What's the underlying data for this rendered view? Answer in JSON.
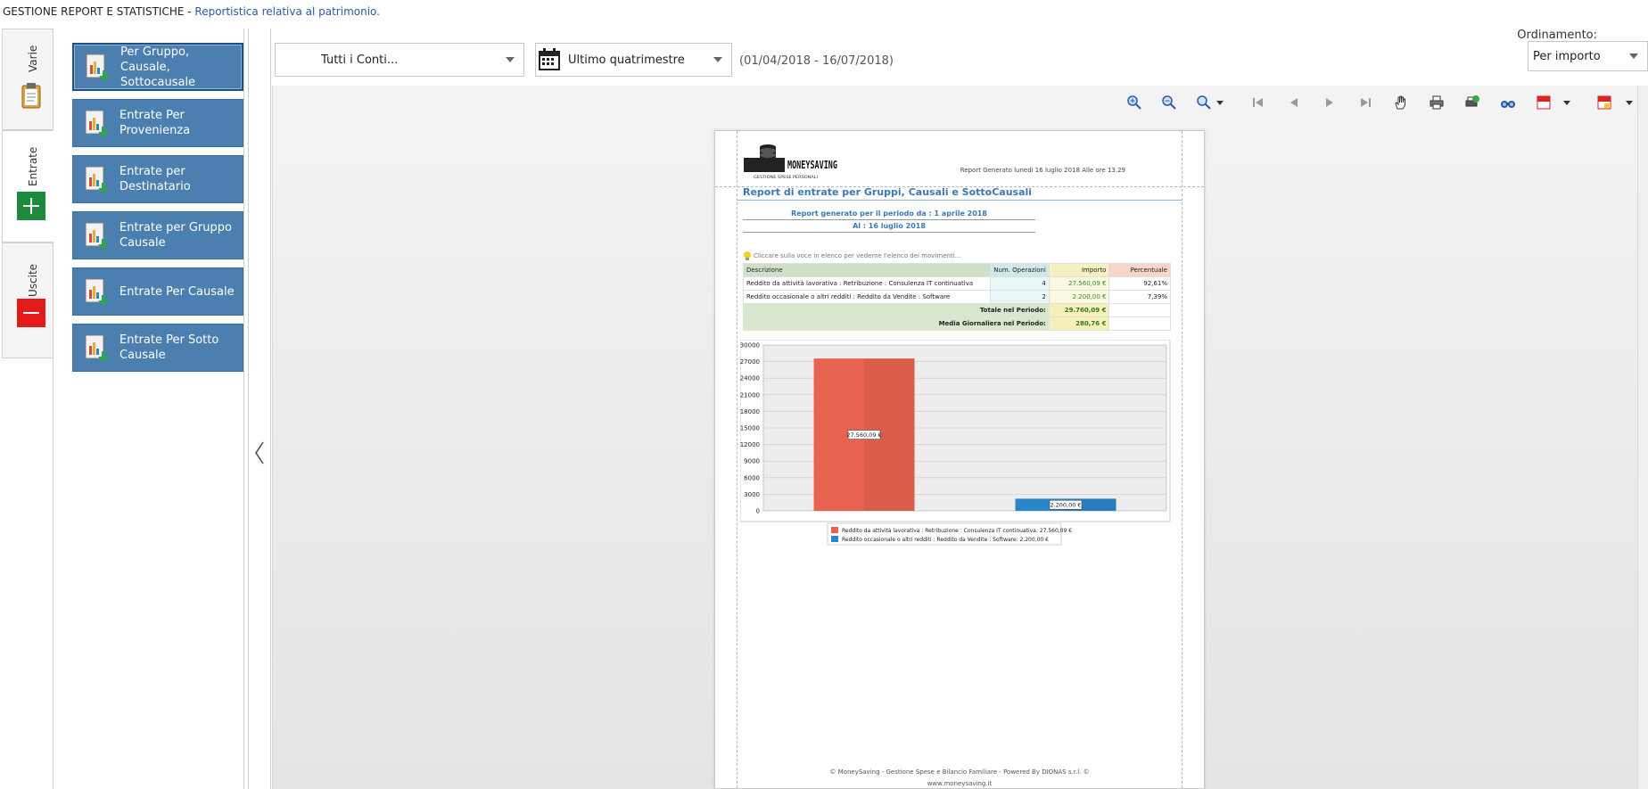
{
  "header": {
    "title": "GESTIONE REPORT E STATISTICHE",
    "separator": " - ",
    "subtitle": "Reportistica relativa al patrimonio."
  },
  "side_tabs": [
    {
      "label": "Varie",
      "icon": "clipboard-icon"
    },
    {
      "label": "Entrate",
      "icon": "plus-icon",
      "active": true
    },
    {
      "label": "Uscite",
      "icon": "minus-icon"
    }
  ],
  "report_menu": [
    {
      "label": "Per Gruppo, Causale, Sottocausale",
      "selected": true
    },
    {
      "label": "Entrate Per Provenienza"
    },
    {
      "label": "Entrate per Destinatario"
    },
    {
      "label": "Entrate per Gruppo Causale"
    },
    {
      "label": "Entrate Per Causale"
    },
    {
      "label": "Entrate Per Sotto Causale"
    }
  ],
  "filters": {
    "accounts_value": "Tutti i Conti...",
    "period_value": "Ultimo quatrimestre",
    "period_range": "(01/04/2018 - 16/07/2018)",
    "ordering_label": "Ordinamento:",
    "ordering_value": "Per importo"
  },
  "toolbar_icons": [
    "zoom-in-icon",
    "zoom-out-icon",
    "zoom-icon",
    "first-page-icon",
    "previous-page-icon",
    "next-page-icon",
    "last-page-icon",
    "hand-tool-icon",
    "print-icon",
    "print-preview-icon",
    "find-icon",
    "export-pdf-icon",
    "send-pdf-icon"
  ],
  "report": {
    "logo_main": "MONEYSAVING",
    "logo_sub": "GESTIONE SPESE PERSONALI",
    "generated_note": "Report Generato lunedì 16 luglio 2018 Alle ore 13.29",
    "title": "Report di entrate per Gruppi, Causali e SottoCausali",
    "period_from": "Report generato per il periodo da : 1 aprile 2018",
    "period_to": "Al : 16 luglio 2018",
    "hint": "Cliccare sulla voce in elenco per vederne l'elenco dei movimenti...",
    "columns": [
      "Descrizione",
      "Num. Operazioni",
      "Importo",
      "Percentuale"
    ],
    "rows": [
      {
        "desc": "Reddito da attività lavorativa : Retribuzione : Consulenza IT continuativa",
        "num": "4",
        "amount": "27.560,09 €",
        "perc": "92,61%"
      },
      {
        "desc": "Reddito occasionale o altri redditi : Reddito da Vendite : Software",
        "num": "2",
        "amount": "2.200,00 €",
        "perc": "7,39%"
      }
    ],
    "total_label": "Totale nel Periodo:",
    "total_value": "29.760,09 €",
    "avg_label": "Media Giornaliera nel Periodo:",
    "avg_value": "280,76 €",
    "footer_1": "© MoneySaving - Gestione Spese e Bilancio Familiare - Powered By DIONAS s.r.l. ©",
    "footer_2": "www.moneysaving.it"
  },
  "chart_data": {
    "type": "bar",
    "categories": [
      "Reddito da attività lavorativa : Retribuzione : Consulenza IT continuativa",
      "Reddito occasionale o altri redditi : Reddito da Vendite : Software"
    ],
    "values": [
      27560.09,
      2200.0
    ],
    "data_labels": [
      "27.560,09 €",
      "2.200,00 €"
    ],
    "legend": [
      "Reddito da attività lavorativa : Retribuzione : Consulenza IT continuativa: 27.560,09 €",
      "Reddito occasionale o altri redditi : Reddito da Vendite : Software: 2.200,00 €"
    ],
    "colors": [
      "#e8634f",
      "#2b86c8"
    ],
    "yticks": [
      "0",
      "3000",
      "6000",
      "9000",
      "12000",
      "15000",
      "18000",
      "21000",
      "24000",
      "27000",
      "30000"
    ],
    "ylim": [
      0,
      30000
    ],
    "grid": true,
    "legend_position": "bottom"
  }
}
